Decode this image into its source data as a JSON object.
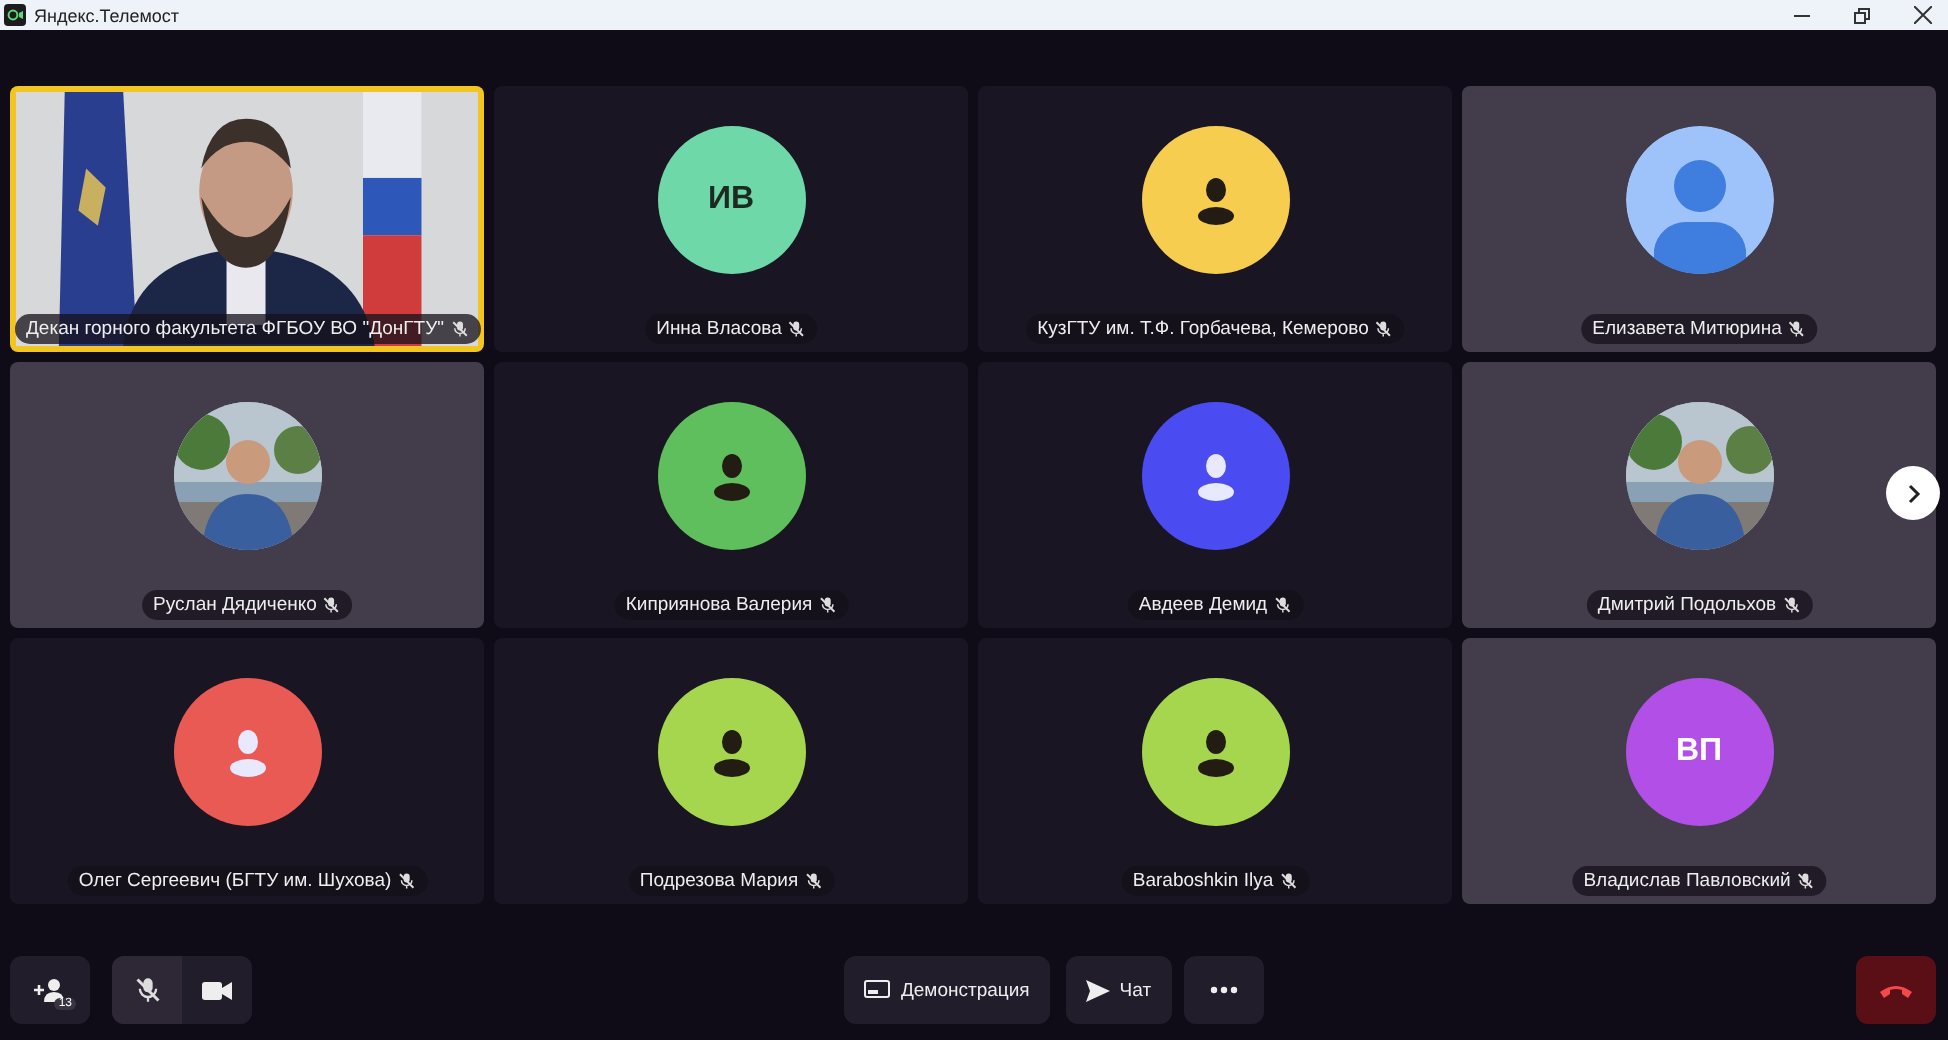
{
  "window": {
    "title": "Яндекс.Телемост"
  },
  "participants": [
    {
      "name": "Декан горного факультета ФГБОУ ВО \"ДонГТУ\"",
      "muted": true,
      "speaking": true,
      "highlighted": false,
      "avatar": {
        "kind": "video"
      }
    },
    {
      "name": "Инна Власова",
      "muted": true,
      "speaking": false,
      "highlighted": false,
      "avatar": {
        "kind": "initials",
        "text": "ИВ",
        "color": "#6fd8a8"
      }
    },
    {
      "name": "КузГТУ им. Т.Ф. Горбачева, Кемерово",
      "muted": true,
      "speaking": false,
      "highlighted": false,
      "avatar": {
        "kind": "person",
        "color": "#f7cd4f"
      }
    },
    {
      "name": "Елизавета Митюрина",
      "muted": true,
      "speaking": false,
      "highlighted": true,
      "avatar": {
        "kind": "silhouette",
        "color": "#9ec2fa"
      }
    },
    {
      "name": "Руслан Дядиченко",
      "muted": true,
      "speaking": false,
      "highlighted": true
    },
    {
      "name": "Киприянова Валерия",
      "muted": true,
      "speaking": false,
      "highlighted": false,
      "avatar": {
        "kind": "person",
        "color": "#5fbf5c"
      }
    },
    {
      "name": "Авдеев Демид",
      "muted": true,
      "speaking": false,
      "highlighted": false,
      "avatar": {
        "kind": "person",
        "color": "#4a4cf2"
      }
    },
    {
      "name": "Дмитрий Подольхов",
      "muted": true,
      "speaking": false,
      "highlighted": true
    },
    {
      "name": "Олег Сергеевич (БГТУ им. Шухова)",
      "muted": true,
      "speaking": false,
      "highlighted": false,
      "avatar": {
        "kind": "person",
        "color": "#ea5a55"
      }
    },
    {
      "name": "Подрезова Мария",
      "muted": true,
      "speaking": false,
      "highlighted": false,
      "avatar": {
        "kind": "person",
        "color": "#a6d64e"
      }
    },
    {
      "name": "Baraboshkin Ilya",
      "muted": true,
      "speaking": false,
      "highlighted": false,
      "avatar": {
        "kind": "person",
        "color": "#a6d64e"
      }
    },
    {
      "name": "Владислав Павловский",
      "muted": true,
      "speaking": false,
      "highlighted": true,
      "avatar": {
        "kind": "initials",
        "text": "ВП",
        "color": "#b24fe6"
      }
    }
  ],
  "toolbar": {
    "participants_count": "13",
    "mic_on": false,
    "camera_on": true,
    "demo_label": "Демонстрация",
    "chat_label": "Чат"
  }
}
